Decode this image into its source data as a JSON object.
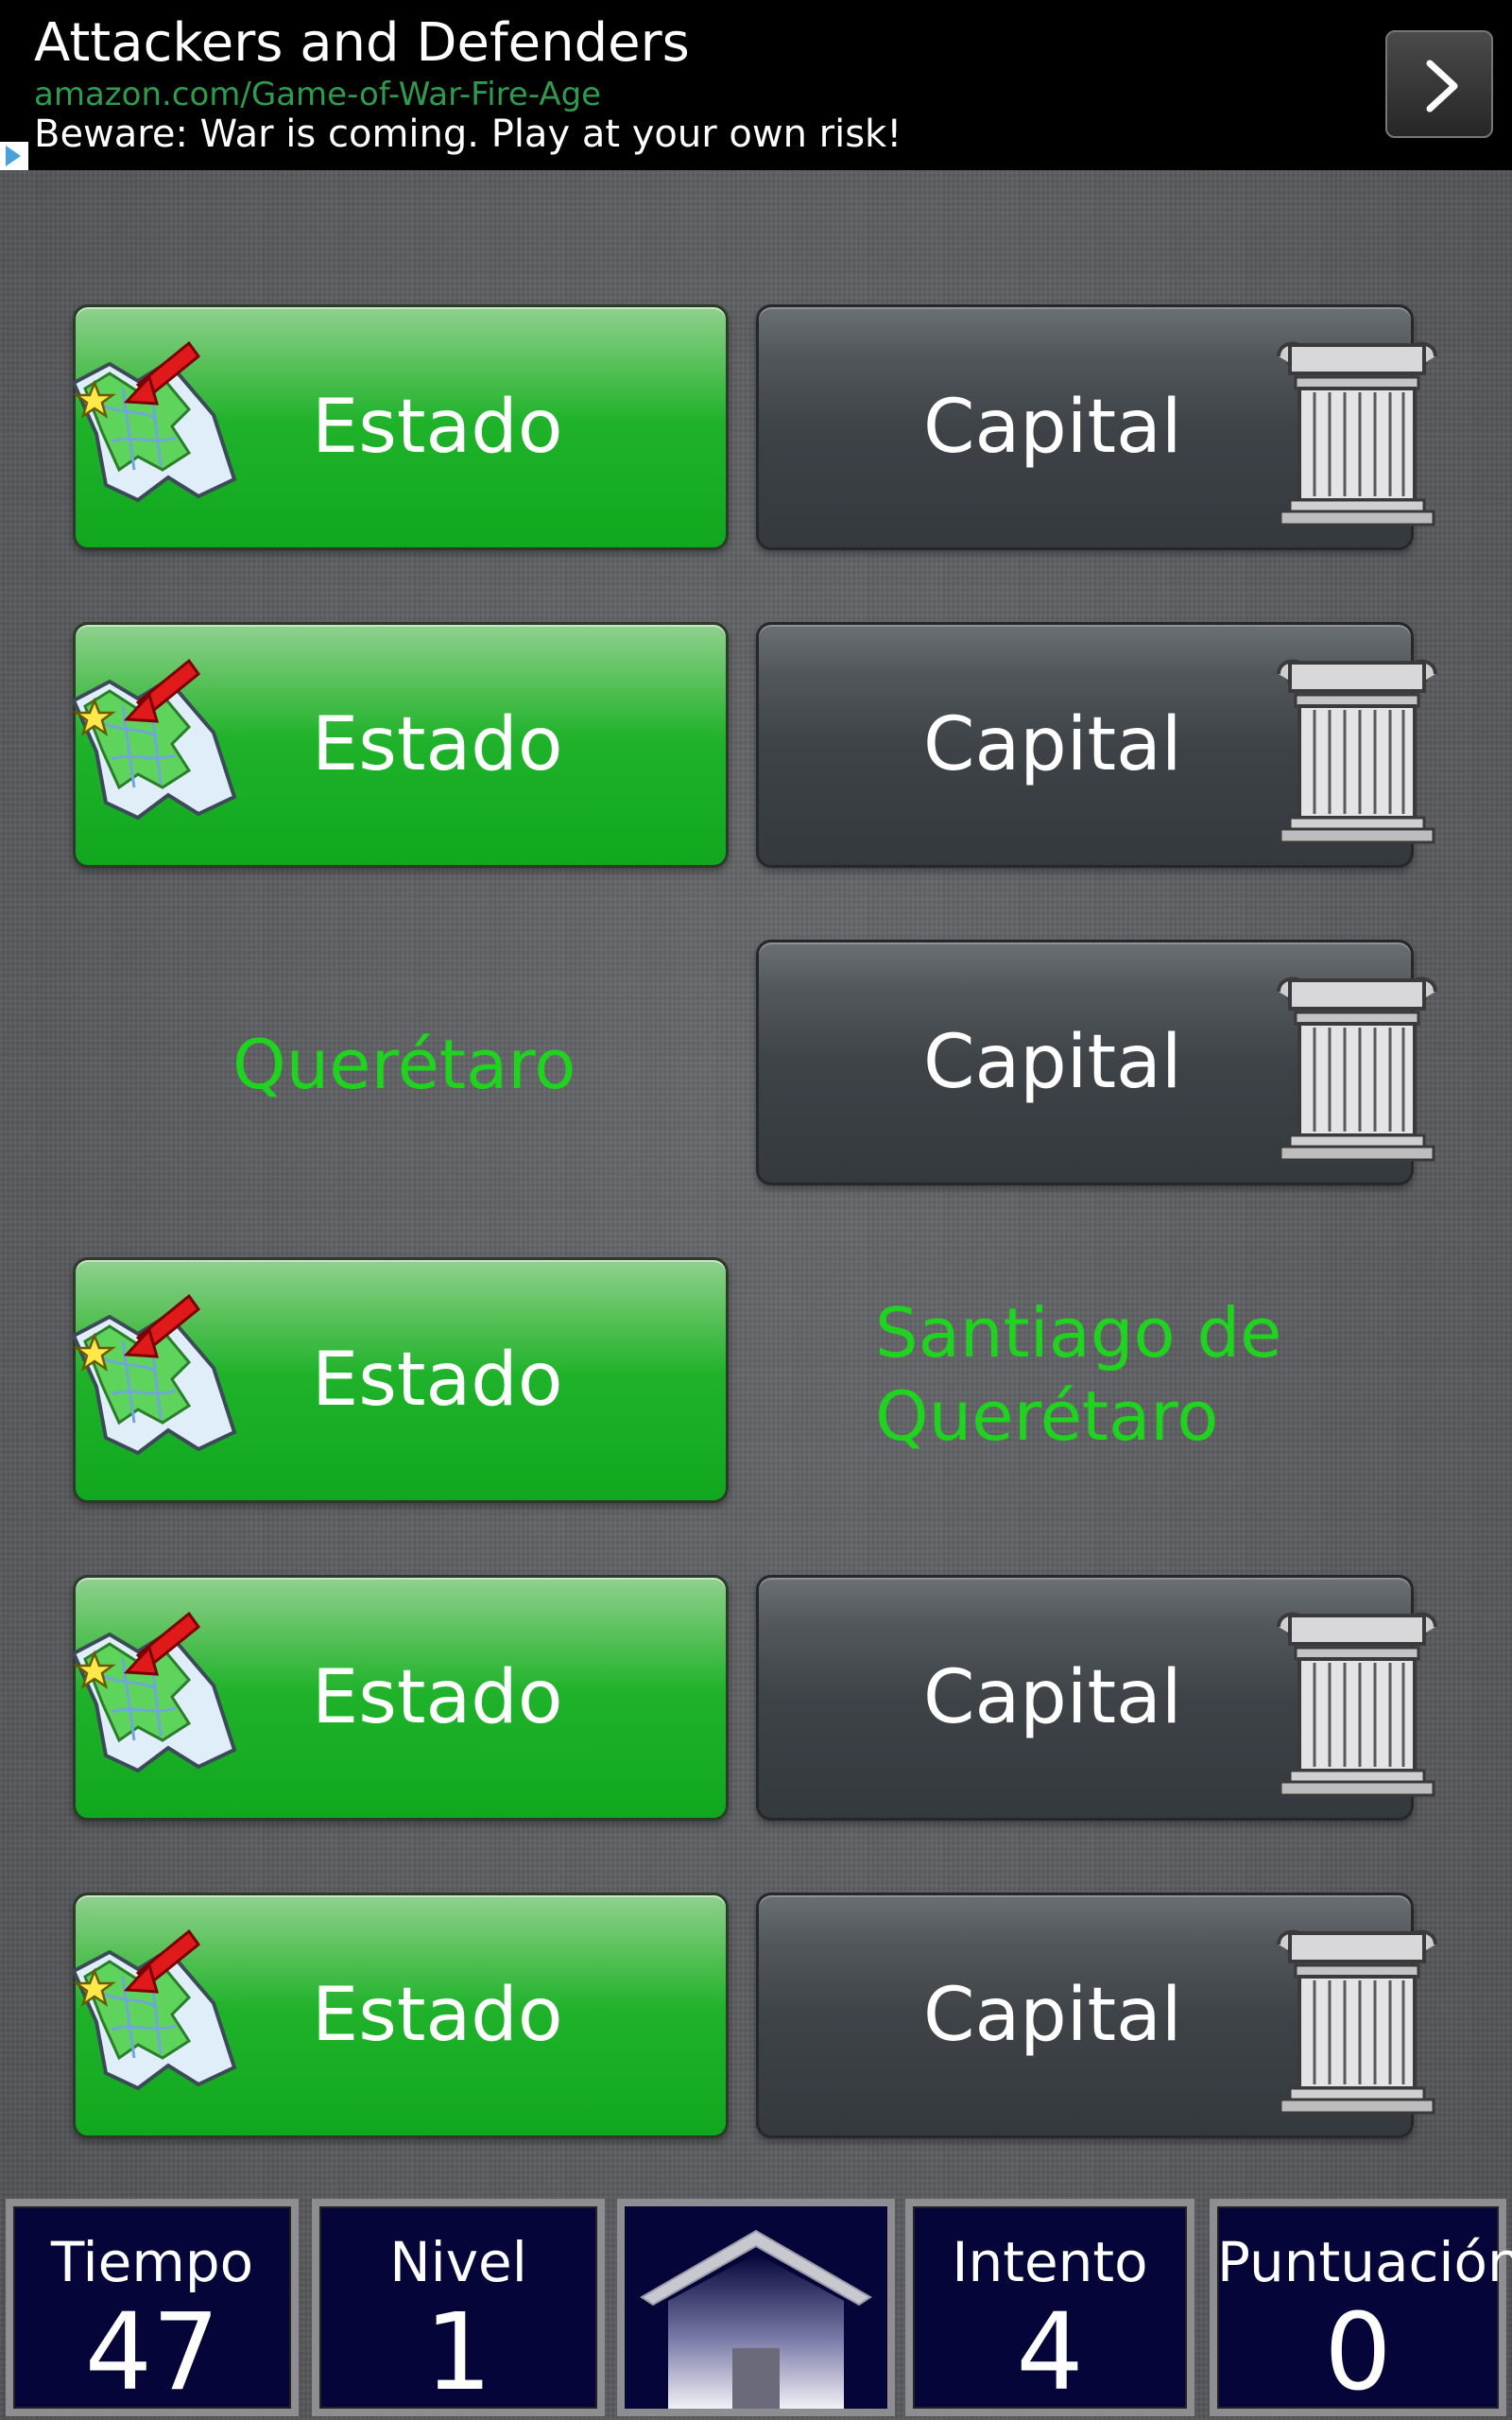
{
  "ad": {
    "title": "Attackers and Defenders",
    "url": "amazon.com/Game-of-War-Fire-Age",
    "text": "Beware: War is coming. Play at your own risk!"
  },
  "rows": [
    {
      "left": "Estado",
      "right": "Capital"
    },
    {
      "left": "Estado",
      "right": "Capital"
    },
    {
      "left": "Querétaro",
      "right": "Capital"
    },
    {
      "left": "Estado",
      "right": "Santiago de Querétaro"
    },
    {
      "left": "Estado",
      "right": "Capital"
    },
    {
      "left": "Estado",
      "right": "Capital"
    }
  ],
  "answers": {
    "state": "Querétaro",
    "capital_line1": "Santiago de",
    "capital_line2": "Querétaro"
  },
  "stats": {
    "time_label": "Tiempo",
    "time_value": "47",
    "level_label": "Nivel",
    "level_value": "1",
    "attempt_label": "Intento",
    "attempt_value": "4",
    "score_label": "Puntuación",
    "score_value": "0"
  },
  "colors": {
    "accent_green": "#1fd41f",
    "button_green": "#10a81e",
    "button_dark": "#3e4348",
    "panel_navy": "#05053a"
  },
  "icons": {
    "state_button": "map-pin-icon",
    "capital_button": "column-icon",
    "home": "home-icon",
    "ad_next": "chevron-right-icon"
  }
}
